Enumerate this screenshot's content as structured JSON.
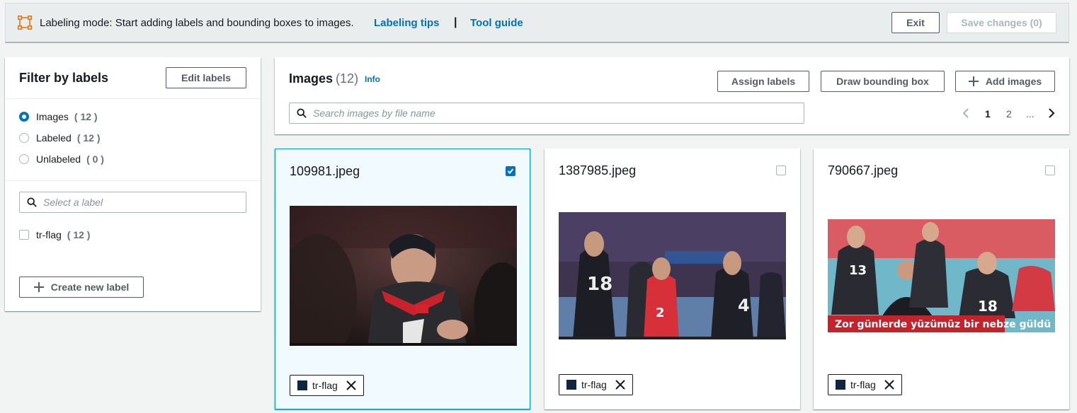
{
  "topbar": {
    "mode_text": "Labeling mode: Start adding labels and bounding boxes to images.",
    "tips_link": "Labeling tips",
    "separator": "|",
    "guide_link": "Tool guide",
    "exit_label": "Exit",
    "save_label": "Save changes (0)"
  },
  "filter": {
    "title": "Filter by labels",
    "edit_label": "Edit labels",
    "options": [
      {
        "label": "Images",
        "count": "( 12 )",
        "selected": true
      },
      {
        "label": "Labeled",
        "count": "( 12 )",
        "selected": false
      },
      {
        "label": "Unlabeled",
        "count": "( 0 )",
        "selected": false
      }
    ],
    "label_search_placeholder": "Select a label",
    "labels": [
      {
        "label": "tr-flag",
        "count": "( 12 )"
      }
    ],
    "create_label": "Create new label"
  },
  "images": {
    "title": "Images",
    "count": "(12)",
    "info": "Info",
    "assign_label": "Assign labels",
    "bbox_label": "Draw bounding box",
    "add_label": "Add images",
    "search_placeholder": "Search images by file name",
    "pages": [
      "1",
      "2",
      "..."
    ],
    "current_page": "1"
  },
  "cards": [
    {
      "filename": "109981.jpeg",
      "checked": true,
      "tag": "tr-flag",
      "caption": ""
    },
    {
      "filename": "1387985.jpeg",
      "checked": false,
      "tag": "tr-flag",
      "caption": ""
    },
    {
      "filename": "790667.jpeg",
      "checked": false,
      "tag": "tr-flag",
      "caption": "Zor günlerde yüzümüz bir nebze güldü"
    }
  ],
  "colors": {
    "accent": "#0073bb",
    "mode_icon": "#ec7211",
    "tag_swatch": "#0f2540",
    "selected_border": "#00a1c9"
  }
}
